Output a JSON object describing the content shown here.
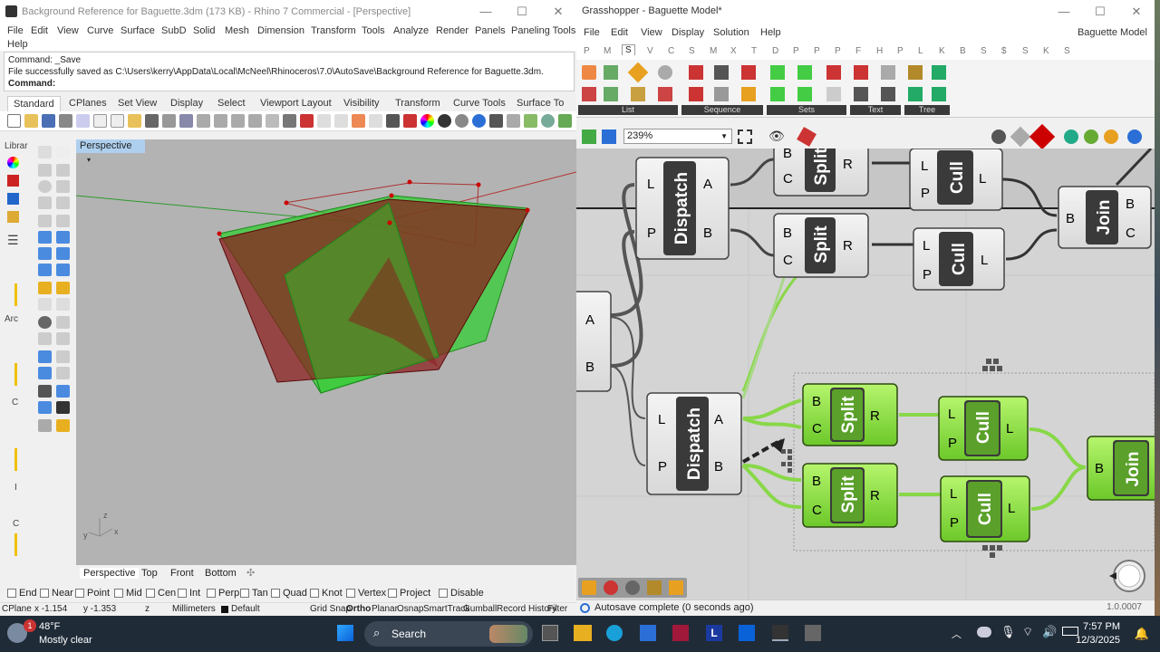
{
  "rhino": {
    "title": "Background Reference for Baguette.3dm (173 KB) - Rhino 7 Commercial - [Perspective]",
    "menu": [
      "File",
      "Edit",
      "View",
      "Curve",
      "Surface",
      "SubD",
      "Solid",
      "Mesh",
      "Dimension",
      "Transform",
      "Tools",
      "Analyze",
      "Render",
      "Panels",
      "Paneling Tools"
    ],
    "menu_help": "Help",
    "command_history": [
      "Command: _Save",
      "File successfully saved as C:\\Users\\kerry\\AppData\\Local\\McNeel\\Rhinoceros\\7.0\\AutoSave\\Background Reference for Baguette.3dm."
    ],
    "command_prompt": "Command:",
    "toolbar_tabs": [
      "Standard",
      "CPlanes",
      "Set View",
      "Display",
      "Select",
      "Viewport Layout",
      "Visibility",
      "Transform",
      "Curve Tools",
      "Surface To"
    ],
    "side_labels": [
      "Librar",
      "Arc",
      "C",
      "I",
      "C"
    ],
    "viewport_label": "Perspective",
    "axis_labels": {
      "x": "x",
      "y": "y",
      "z": "z"
    },
    "viewport_tabs": [
      "Perspective",
      "Top",
      "Front",
      "Bottom"
    ],
    "osnaps": [
      "End",
      "Near",
      "Point",
      "Mid",
      "Cen",
      "Int",
      "Perp",
      "Tan",
      "Quad",
      "Knot",
      "Vertex",
      "Project",
      "Disable"
    ],
    "status": {
      "cplane": "CPlane",
      "x": "x -1.154",
      "y": "y -1.353",
      "z": "z",
      "units": "Millimeters",
      "layer": "Default",
      "toggles": [
        "Grid Snap",
        "Ortho",
        "Planar",
        "Osnap",
        "SmartTrack",
        "Gumball",
        "Record History",
        "Filter"
      ]
    }
  },
  "gh": {
    "title": "Grasshopper - Baguette Model*",
    "menu": [
      "File",
      "Edit",
      "View",
      "Display",
      "Solution",
      "Help"
    ],
    "doc_name": "Baguette Model",
    "tabs": [
      "P",
      "M",
      "S",
      "V",
      "C",
      "S",
      "M",
      "X",
      "T",
      "D",
      "P",
      "P",
      "P",
      "F",
      "H",
      "P",
      "L",
      "K",
      "B",
      "S",
      "$",
      "S",
      "K",
      "S"
    ],
    "active_tab": "S",
    "ribbon_groups": [
      "List",
      "Sequence",
      "Sets",
      "Text",
      "Tree"
    ],
    "zoom": "239%",
    "components": {
      "dispatch": "Dispatch",
      "split": "Split",
      "cull": "Cull",
      "join": "Join"
    },
    "ports": {
      "L": "L",
      "P": "P",
      "A": "A",
      "B": "B",
      "C": "C",
      "R": "R"
    },
    "status_text": "Autosave complete (0 seconds ago)",
    "version": "1.0.0007"
  },
  "taskbar": {
    "weather_temp": "48°F",
    "weather_desc": "Mostly clear",
    "weather_badge": "1",
    "search": "Search",
    "time": "7:57 PM",
    "date": "12/3/2025"
  },
  "colors": {
    "viewport_bg": "#b3b3b3",
    "gh_canvas": "#d4d4d4",
    "component_green": "#8ee04a",
    "component_dark": "#3a3a3a",
    "wire_green": "#88d848",
    "taskbar": "#202b38"
  }
}
